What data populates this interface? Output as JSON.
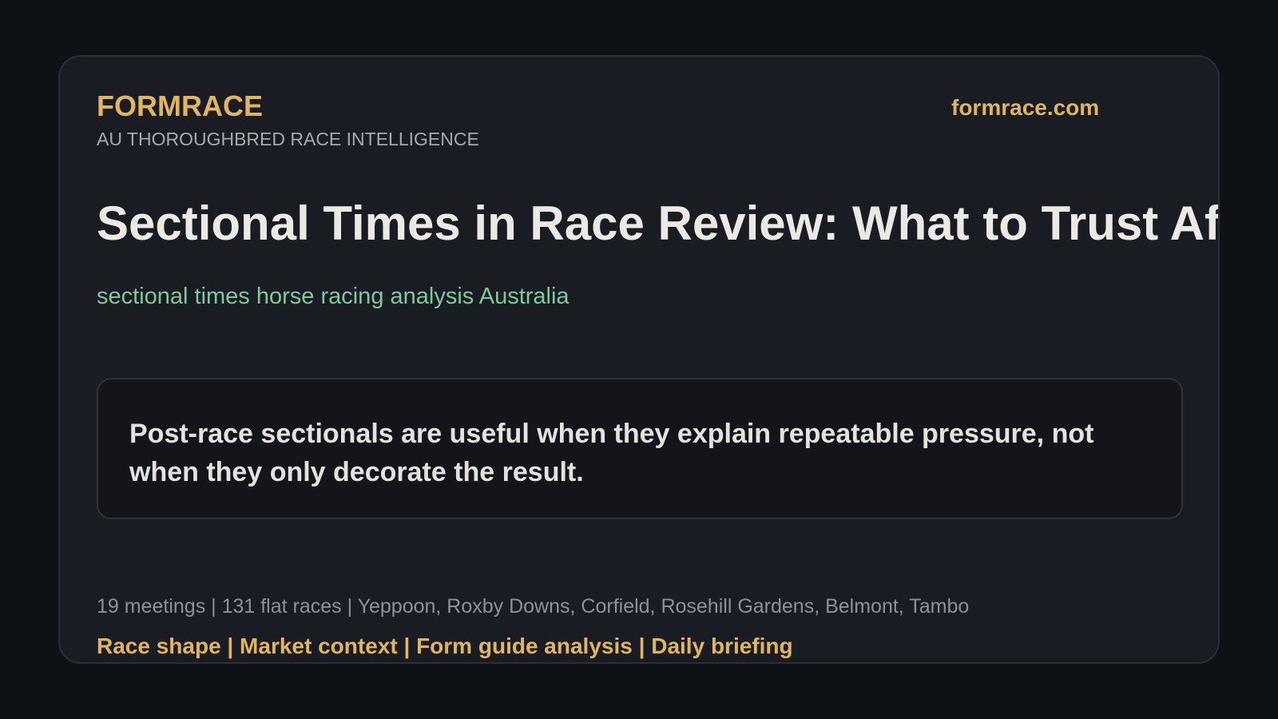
{
  "header": {
    "brand": "FORMRACE",
    "tagline": "AU THOROUGHBRED RACE INTELLIGENCE",
    "domain": "formrace.com"
  },
  "article": {
    "headline": "Sectional Times in Race Review: What to Trust After the Run",
    "keyword": "sectional times horse racing analysis Australia",
    "quote": "Post-race sectionals are useful when they explain repeatable pressure, not when they only decorate the result."
  },
  "footer": {
    "stats": "19 meetings | 131 flat races | Yeppoon, Roxby Downs, Corfield, Rosehill Gardens, Belmont, Tambo",
    "topics": [
      "Race shape",
      "Market context",
      "Form guide analysis",
      "Daily briefing"
    ],
    "separator": " | "
  },
  "colors": {
    "background": "#0e1115",
    "card": "#191c23",
    "accent": "#e1b55e",
    "keyword": "#7fc99a",
    "headline": "#ece9e3"
  }
}
